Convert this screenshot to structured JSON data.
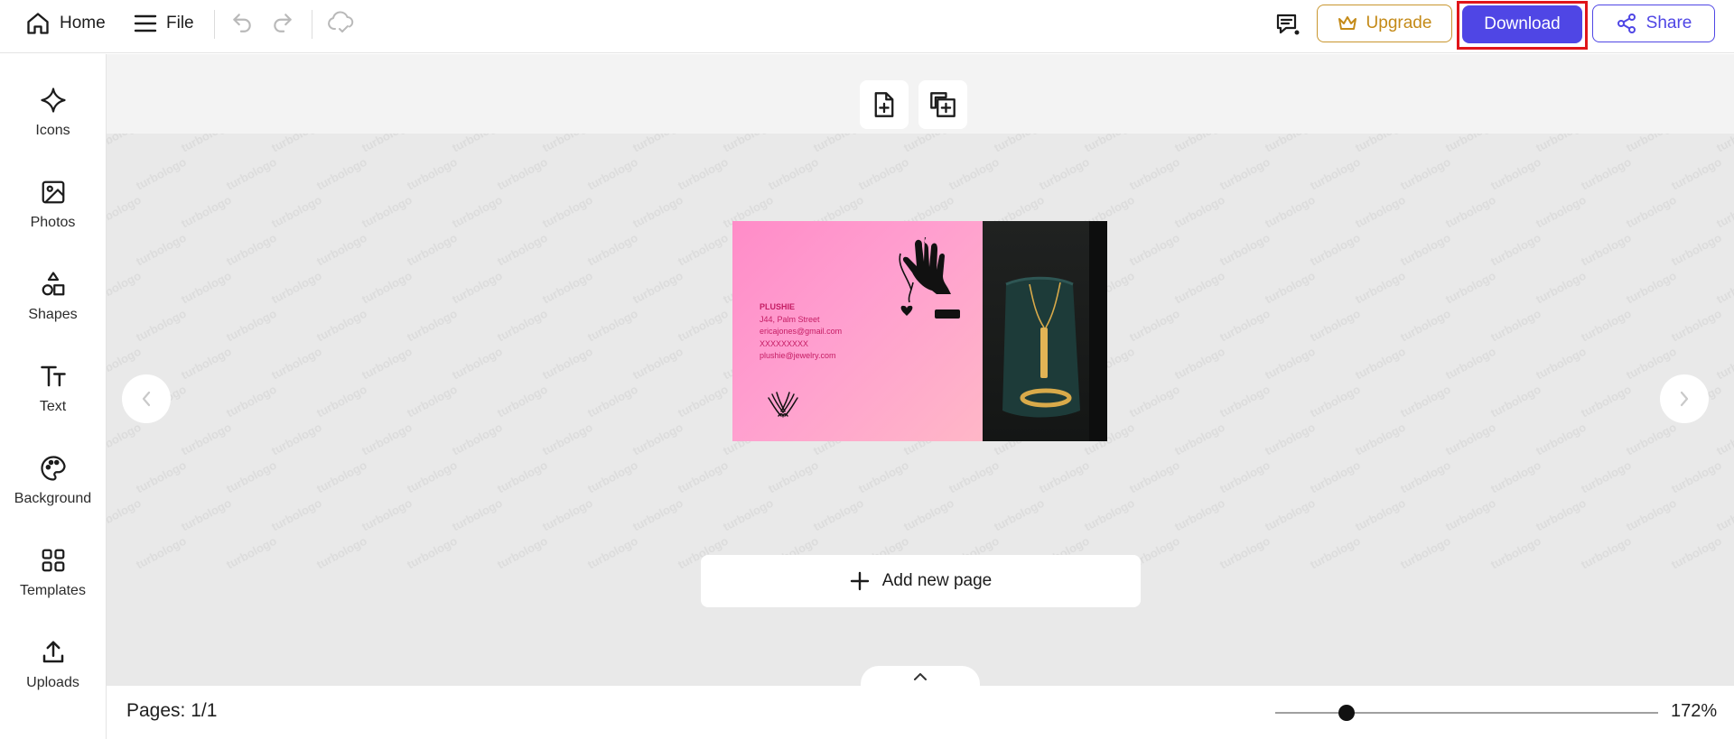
{
  "topbar": {
    "home_label": "Home",
    "file_label": "File",
    "upgrade_label": "Upgrade",
    "download_label": "Download",
    "share_label": "Share",
    "icons": [
      "home-icon",
      "menu-icon",
      "undo-icon",
      "redo-icon",
      "cloud-sync-icon",
      "feedback-icon",
      "crown-icon",
      "share-icon"
    ]
  },
  "sidebar": {
    "items": [
      {
        "label": "Icons",
        "icon": "sparkle-icon"
      },
      {
        "label": "Photos",
        "icon": "image-icon"
      },
      {
        "label": "Shapes",
        "icon": "shapes-icon"
      },
      {
        "label": "Text",
        "icon": "text-icon"
      },
      {
        "label": "Background",
        "icon": "palette-icon"
      },
      {
        "label": "Templates",
        "icon": "grid-icon"
      },
      {
        "label": "Uploads",
        "icon": "upload-icon"
      }
    ]
  },
  "canvas": {
    "watermark_text": "turbologo",
    "card": {
      "brand": "PLUSHIE",
      "address": "J44, Palm Street",
      "email": "ericajones@gmail.com",
      "phone": "XXXXXXXXX",
      "website": "plushie@jewelry.com"
    },
    "add_page_label": "Add new page"
  },
  "bottombar": {
    "pages_label": "Pages: 1/1",
    "zoom_label": "172%"
  },
  "colors": {
    "accent": "#4f46e5",
    "upgrade": "#c48a18",
    "highlight_frame": "#e0151a",
    "card_text": "#c51d64"
  }
}
